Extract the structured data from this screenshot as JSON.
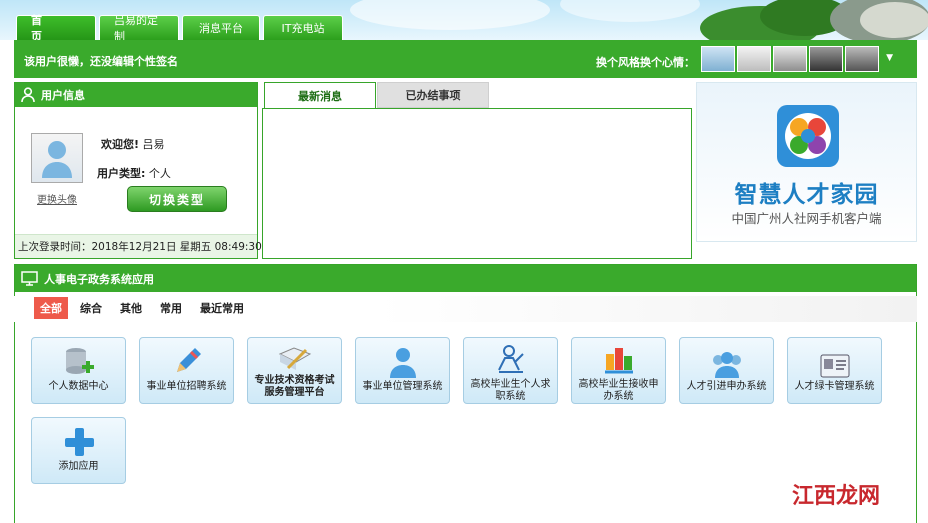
{
  "top_tabs": [
    "首　页",
    "吕易的定制",
    "消息平台",
    "IT充电站"
  ],
  "header": {
    "signature_hint": "该用户很懒，还没编辑个性签名",
    "mood_label": "换个风格换个心情：",
    "dropdown_icon": "caret-down-icon"
  },
  "user_panel": {
    "title": "用户信息",
    "welcome_label": "欢迎您!",
    "username": "吕易",
    "type_label": "用户类型:",
    "type_value": "个人",
    "change_avatar": "更换头像",
    "switch_button": "切换类型",
    "last_login": "上次登录时间：2018年12月21日 星期五 08:49:30"
  },
  "message_tabs": [
    "最新消息",
    "已办结事项"
  ],
  "promo": {
    "title": "智慧人才家园",
    "subtitle": "中国广州人社网手机客户端"
  },
  "apps_panel": {
    "title": "人事电子政务系统应用",
    "filters": [
      "全部",
      "综合",
      "其他",
      "常用",
      "最近常用"
    ],
    "apps": [
      {
        "label": "个人数据中心",
        "icon": "database-add-icon"
      },
      {
        "label": "事业单位招聘系统",
        "icon": "pencil-icon"
      },
      {
        "label": "专业技术资格考试服务管理平台",
        "icon": "certificate-pen-icon"
      },
      {
        "label": "事业单位管理系统",
        "icon": "person-icon"
      },
      {
        "label": "高校毕业生个人求职系统",
        "icon": "graduate-job-icon"
      },
      {
        "label": "高校毕业生接收申办系统",
        "icon": "graduate-receive-icon"
      },
      {
        "label": "人才引进申办系统",
        "icon": "group-people-icon"
      },
      {
        "label": "人才绿卡管理系统",
        "icon": "card-icon"
      },
      {
        "label": "添加应用",
        "icon": "plus-icon"
      }
    ]
  },
  "watermark": "江西龙网",
  "colors": {
    "primary_green": "#3aaa2c",
    "accent_red": "#ee5a4b",
    "promo_blue": "#1d7fc3"
  }
}
